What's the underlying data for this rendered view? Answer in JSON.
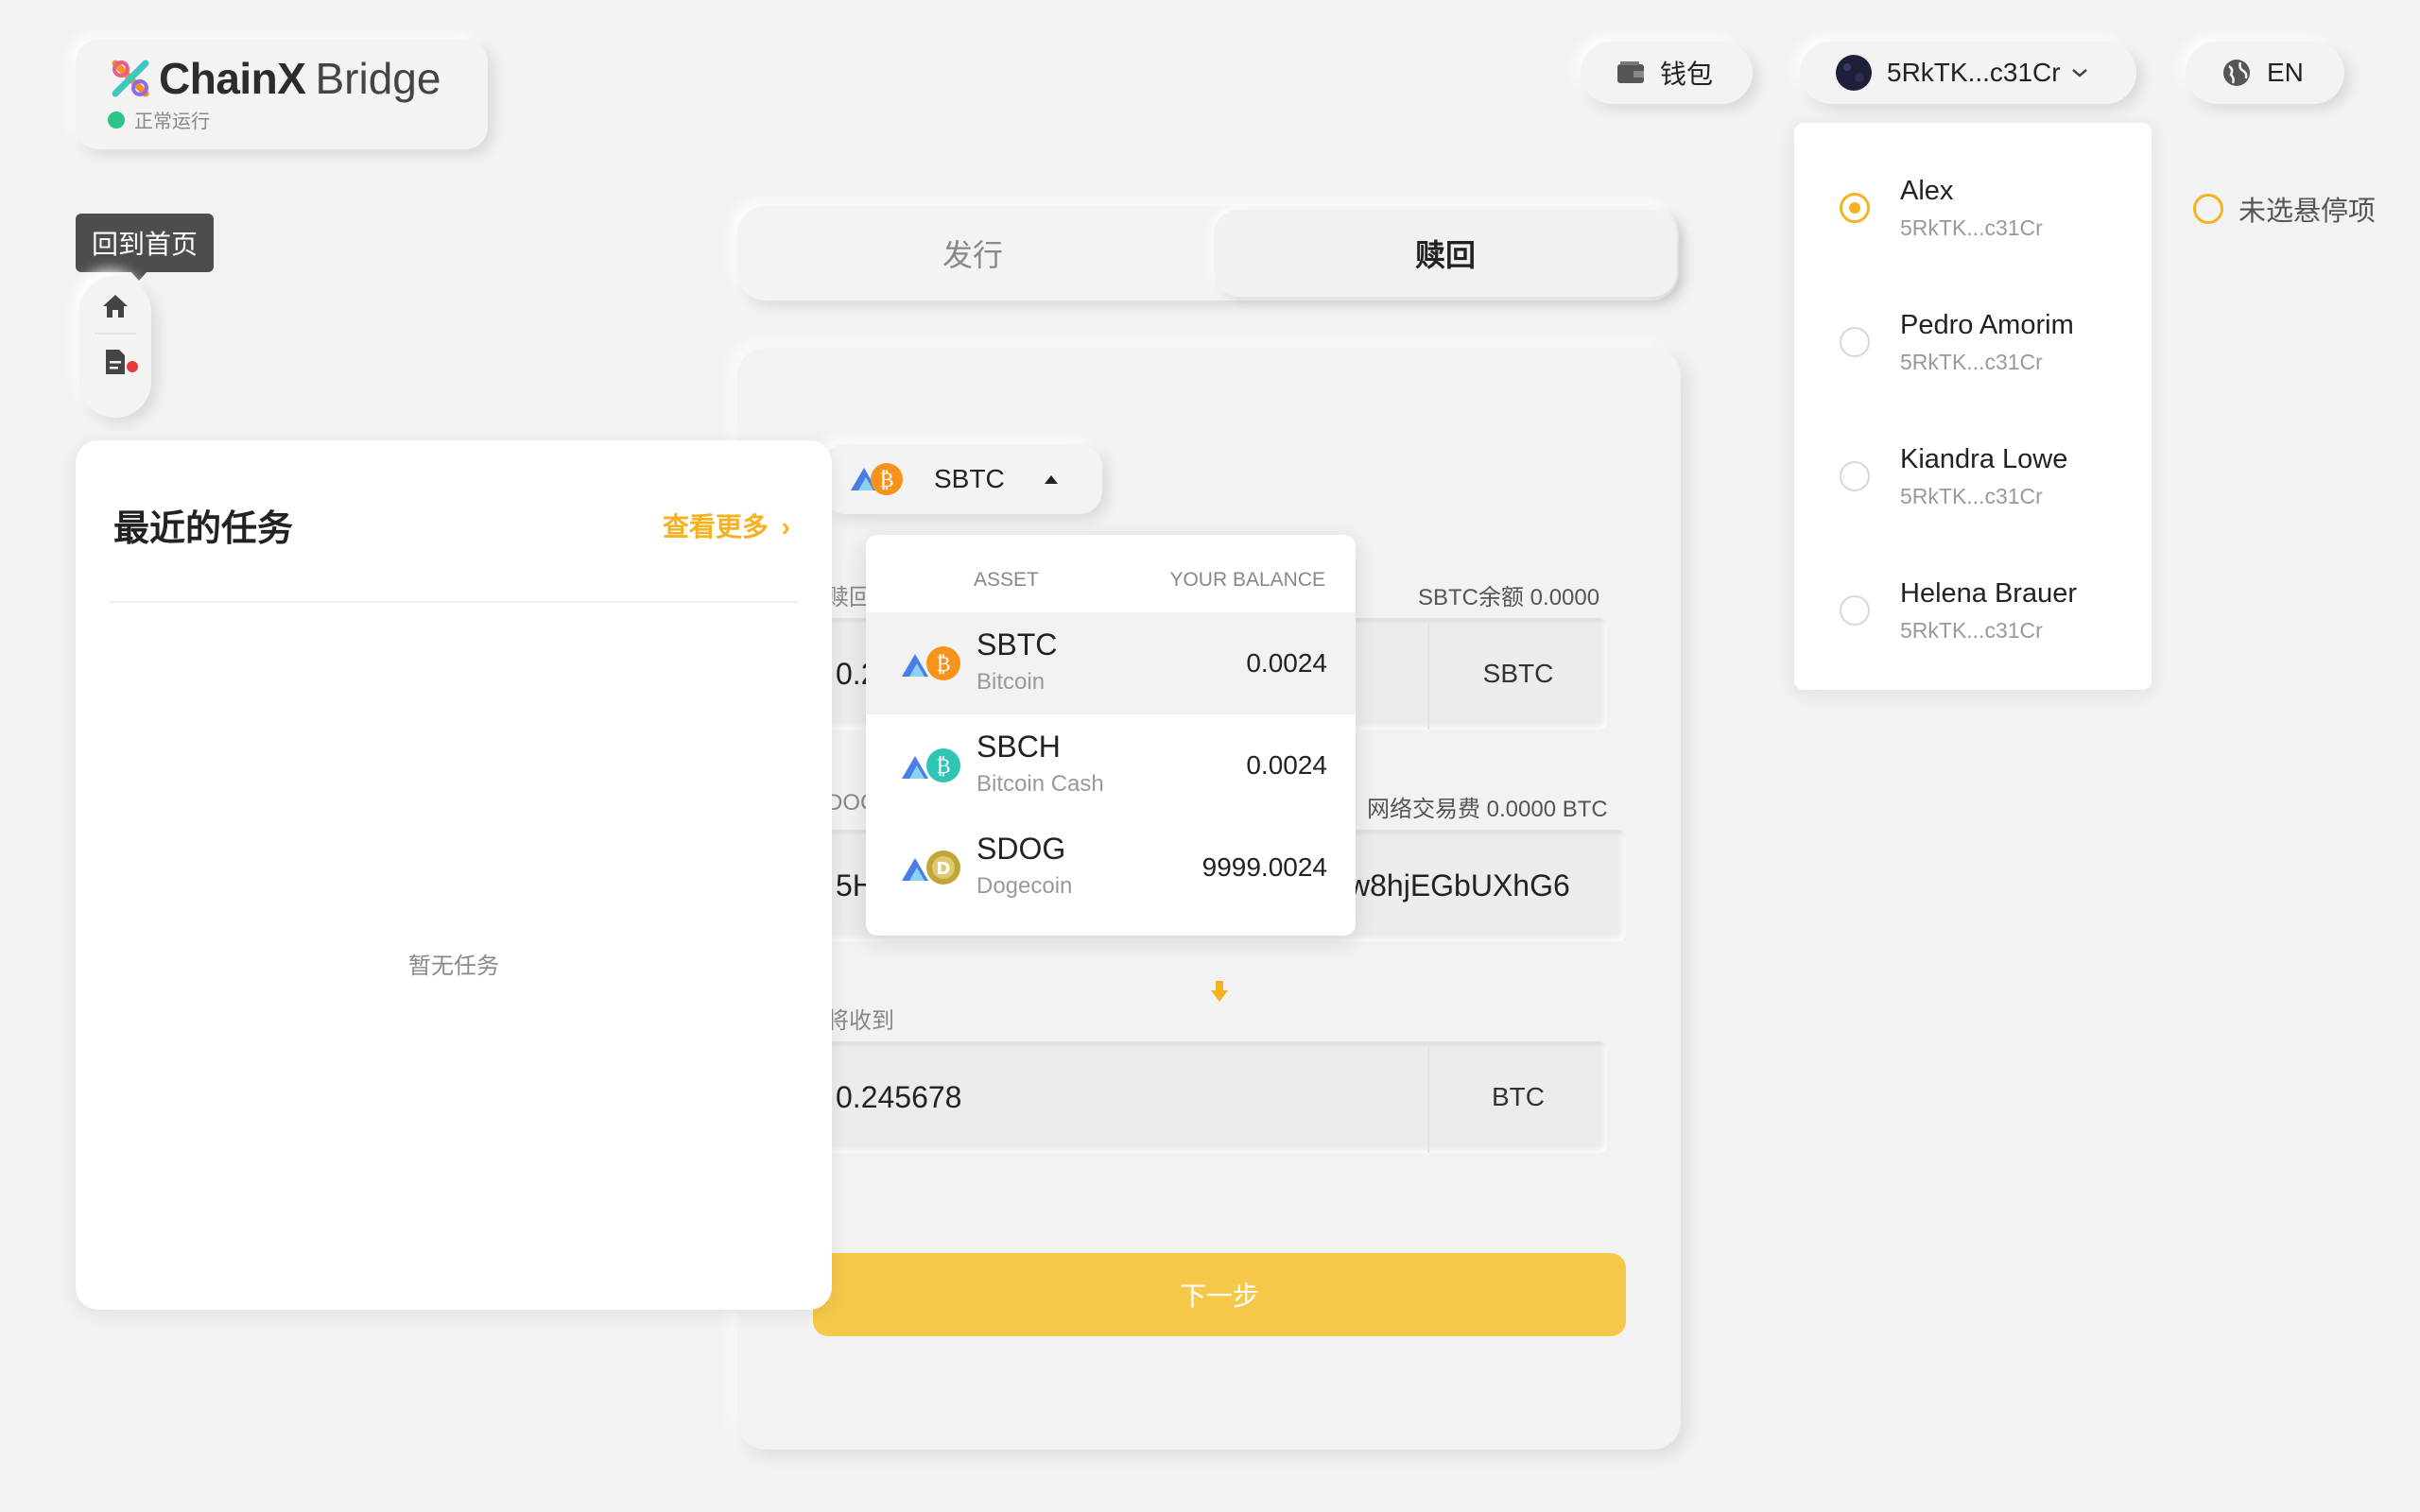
{
  "brand": {
    "name_bold": "ChainX",
    "name_light": "Bridge",
    "status": "正常运行"
  },
  "header": {
    "wallet_label": "钱包",
    "account_short": "5RkTK...c31Cr",
    "language": "EN"
  },
  "sidebar": {
    "tooltip": "回到首页"
  },
  "tasks": {
    "title": "最近的任务",
    "more": "查看更多",
    "empty": "暂无任务"
  },
  "tabs": [
    {
      "label": "发行"
    },
    {
      "label": "赎回"
    }
  ],
  "form": {
    "asset_selected": "SBTC",
    "amount_label": "赎回金额",
    "balance_label": "SBTC余额 0.0000",
    "amount_value": "0.2",
    "amount_unit": "SBTC",
    "address_label": "DOG",
    "fee_label": "网络交易费 0.0000 BTC",
    "address_value_start": "5H",
    "address_value_end": "w8hjEGbUXhG6",
    "receive_label": "将收到",
    "receive_value": "0.245678",
    "receive_unit": "BTC",
    "next_label": "下一步"
  },
  "asset_dropdown": {
    "col_asset": "ASSET",
    "col_balance": "YOUR BALANCE",
    "items": [
      {
        "symbol": "SBTC",
        "name": "Bitcoin",
        "balance": "0.0024",
        "color": "#f7931a",
        "selected": true
      },
      {
        "symbol": "SBCH",
        "name": "Bitcoin Cash",
        "balance": "0.0024",
        "color": "#2fc5b5",
        "selected": false
      },
      {
        "symbol": "SDOG",
        "name": "Dogecoin",
        "balance": "9999.0024",
        "color": "#c2a633",
        "selected": false
      }
    ]
  },
  "accounts": [
    {
      "name": "Alex",
      "address": "5RkTK...c31Cr",
      "selected": true
    },
    {
      "name": "Pedro Amorim",
      "address": "5RkTK...c31Cr",
      "selected": false
    },
    {
      "name": "Kiandra Lowe",
      "address": "5RkTK...c31Cr",
      "selected": false
    },
    {
      "name": "Helena Brauer",
      "address": "5RkTK...c31Cr",
      "selected": false
    }
  ],
  "hover_state": {
    "label": "未选悬停项"
  },
  "colors": {
    "accent": "#f5b220",
    "button": "#f5c84a",
    "status_ok": "#2bc48a"
  }
}
